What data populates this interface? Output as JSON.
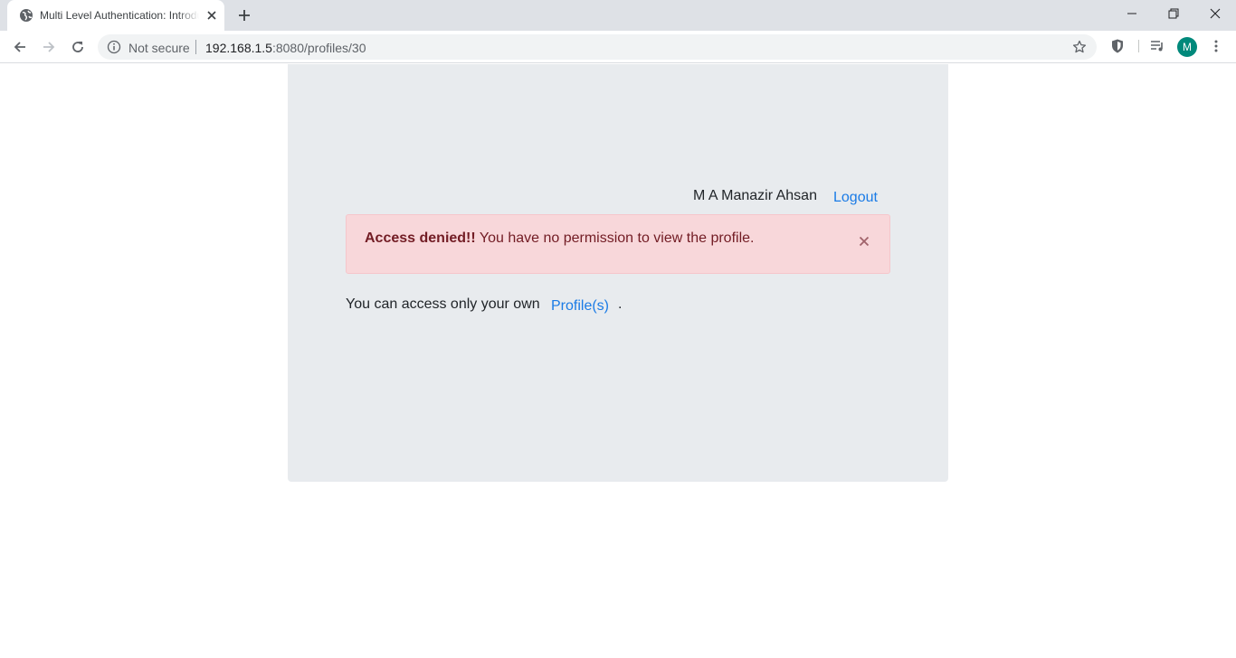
{
  "browser": {
    "tab_title": "Multi Level Authentication: Introduction",
    "security_label": "Not secure",
    "url_host": "192.168.1.5",
    "url_rest": ":8080/profiles/30",
    "avatar_initial": "M"
  },
  "page": {
    "user_name": "M A Manazir Ahsan",
    "logout_label": "Logout",
    "alert": {
      "strong": "Access denied!!",
      "message": " You have no permission to view the profile.",
      "close_label": "×"
    },
    "access_text": "You can access only your own",
    "profiles_link": "Profile(s)",
    "period": "."
  },
  "colors": {
    "jumbotron_bg": "#e8ebee",
    "link": "#1a7be6",
    "alert_bg": "#f8d7da",
    "alert_text": "#721c24",
    "avatar_bg": "#00897b"
  }
}
